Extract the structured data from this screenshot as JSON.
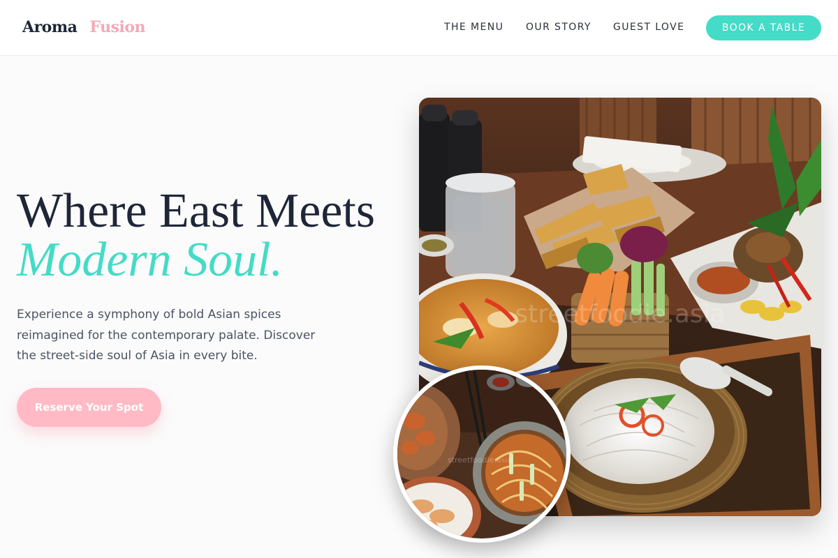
{
  "brand": {
    "word1": "Aroma",
    "word2": "Fusion"
  },
  "nav": {
    "items": [
      {
        "label": "THE MENU"
      },
      {
        "label": "OUR STORY"
      },
      {
        "label": "GUEST LOVE"
      }
    ],
    "cta_label": "BOOK A TABLE"
  },
  "hero": {
    "headline_line1": "Where East Meets",
    "headline_line2": "Modern Soul.",
    "description": "Experience a symphony of bold Asian spices reimagined for the contemporary palate. Discover the street-side soul of Asia in every bite.",
    "cta_label": "Reserve Your Spot"
  },
  "images": {
    "main_watermark": "streetfoodie.asia",
    "inset_watermark": "streetfoodie.asia"
  },
  "colors": {
    "primary_text": "#1e2638",
    "accent_teal": "#44dbc7",
    "accent_pink": "#f4a8b6",
    "button_pink": "#ffbac5",
    "body_text": "#4a5262"
  }
}
